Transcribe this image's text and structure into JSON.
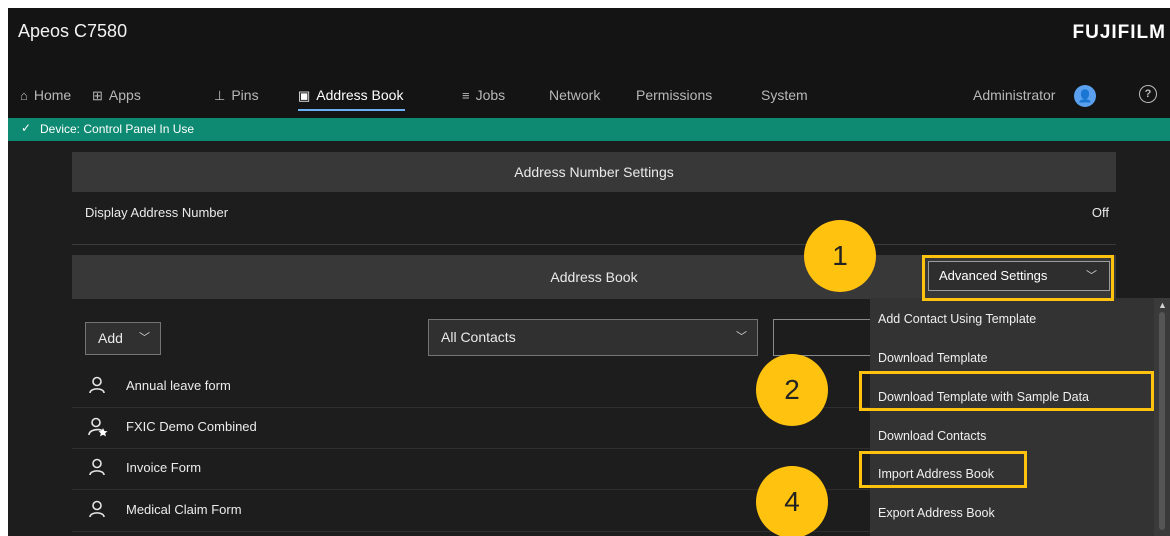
{
  "app": {
    "title": "Apeos C7580",
    "brand": "FUJIFILM"
  },
  "nav": {
    "items": [
      {
        "label": "Home",
        "icon": "home-icon",
        "glyph": "⌂"
      },
      {
        "label": "Apps",
        "icon": "apps-grid-icon",
        "glyph": "⊞"
      },
      {
        "label": "Pins",
        "icon": "pin-icon",
        "glyph": "⊥"
      },
      {
        "label": "Address Book",
        "icon": "address-book-icon",
        "glyph": "▣"
      },
      {
        "label": "Jobs",
        "icon": "jobs-icon",
        "glyph": "≡"
      },
      {
        "label": "Network"
      },
      {
        "label": "Permissions"
      },
      {
        "label": "System"
      }
    ],
    "active": "Address Book",
    "user_label": "Administrator",
    "user_avatar_glyph": "👤",
    "help_glyph": "?"
  },
  "status": {
    "text": "Device: Control Panel In Use",
    "check_glyph": "✓",
    "color": "#0f8a72"
  },
  "address_number_settings": {
    "header": "Address Number Settings",
    "display_address_number": {
      "label": "Display Address Number",
      "value": "Off"
    }
  },
  "address_book": {
    "header": "Address Book",
    "advanced_settings_label": "Advanced Settings",
    "add_select": {
      "value": "Add"
    },
    "filter_select": {
      "value": "All Contacts"
    },
    "contacts": [
      {
        "name": "Annual leave form",
        "icon": "person-icon"
      },
      {
        "name": "FXIC Demo Combined",
        "icon": "person-star-icon"
      },
      {
        "name": "Invoice Form",
        "icon": "person-icon"
      },
      {
        "name": "Medical Claim Form",
        "icon": "person-icon"
      }
    ]
  },
  "advanced_menu": {
    "items": [
      "Add Contact Using Template",
      "Download Template",
      "Download Template with Sample Data",
      "Download Contacts",
      "Import Address Book",
      "Export Address Book"
    ]
  },
  "callouts": {
    "one": "1",
    "two": "2",
    "four": "4",
    "color": "#ffc20e"
  }
}
